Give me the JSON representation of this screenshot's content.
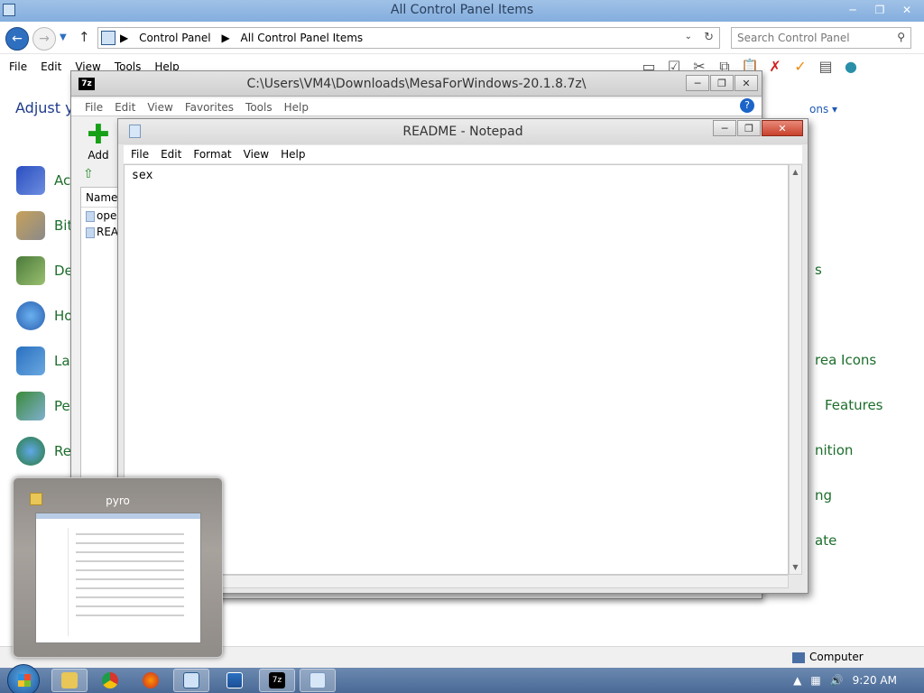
{
  "control_panel": {
    "title": "All Control Panel Items",
    "address": {
      "crumbs": [
        "Control Panel",
        "All Control Panel Items"
      ]
    },
    "search_placeholder": "Search Control Panel",
    "menu": [
      "File",
      "Edit",
      "View",
      "Tools",
      "Help"
    ],
    "header_text": "Adjust yo",
    "view_by_text": "ons",
    "left_items": [
      "Ac",
      "Bit",
      "De",
      "Ho",
      "La",
      "Pe",
      "Re"
    ],
    "right_items": [
      "s",
      "rea Icons",
      "Features",
      "nition",
      "ng",
      "ate"
    ],
    "status": "Computer"
  },
  "sevenzip": {
    "title": "C:\\Users\\VM4\\Downloads\\MesaForWindows-20.1.8.7z\\",
    "logo": "7z",
    "menu": [
      "File",
      "Edit",
      "View",
      "Favorites",
      "Tools",
      "Help"
    ],
    "add_label": "Add",
    "list_header": "Name",
    "files": [
      "ope",
      "REA"
    ]
  },
  "notepad": {
    "title": "README - Notepad",
    "menu": [
      "File",
      "Edit",
      "Format",
      "View",
      "Help"
    ],
    "content": "sex"
  },
  "thumbnail": {
    "title": "pyro"
  },
  "taskbar": {
    "clock": "9:20 AM"
  },
  "colors": {
    "link_green": "#1d6e2c",
    "title_blue": "#84aede",
    "taskbar": "#4a6a96",
    "close_red": "#c8412c"
  }
}
